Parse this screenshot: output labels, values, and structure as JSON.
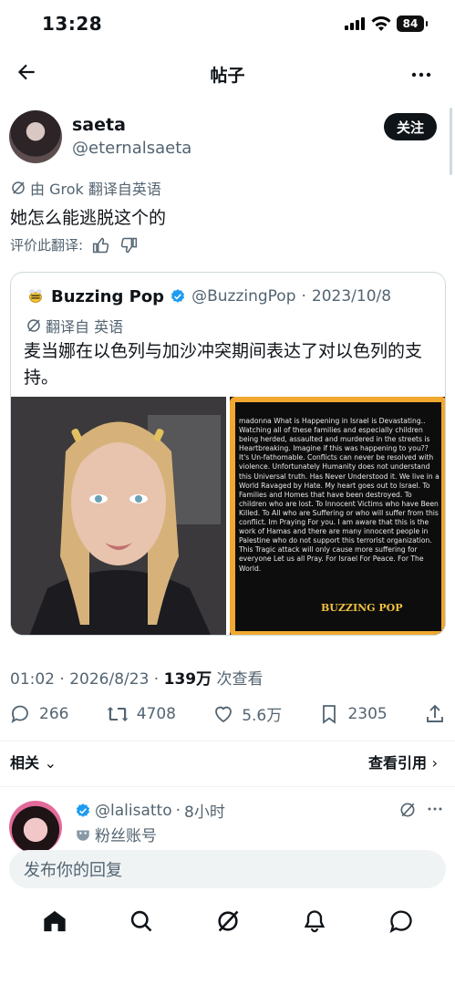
{
  "status": {
    "time": "13:28",
    "battery": "84"
  },
  "header": {
    "title": "帖子"
  },
  "post": {
    "author_name": "saeta",
    "author_handle": "@eternalsaeta",
    "follow_label": "关注",
    "translated_by": "由 Grok 翻译自英语",
    "text": "她怎么能逃脱这个的",
    "rate_label": "评价此翻译:"
  },
  "quote": {
    "name": "Buzzing Pop",
    "handle": "@BuzzingPop",
    "date": "2023/10/8",
    "translated_label": "翻译自 英语",
    "text": "麦当娜在以色列与加沙冲突期间表达了对以色列的支持。",
    "image_text": "madonna What is  Happening in Israel  is Devastating.. Watching all of these families and especially children being herded, assaulted and murdered in the streets  is Heartbreaking. Imagine if this was happening to you?? It's Un-fathomable. Conflicts can never be resolved  with violence. Unfortunately Humanity  does not understand this Universal  truth.  Has Never Understood it. We live in a World Ravaged by Hate. My heart goes out to Israel. To Families  and Homes that have been destroyed. To children who  are lost. To Innocent Victims who have Been Killed. To All  who are Suffering or who will suffer from this conflict. Im Praying For you.  I am aware that this is the work of Hamas and there are many innocent people in Palestine who do not support this terrorist organization. This Tragic attack will only cause more suffering for everyone Let us all Pray.  For Israel  For Peace. For The World.",
    "image_logo": "BUZZING POP"
  },
  "stats": {
    "time": "01:02",
    "date": "2026/8/23",
    "views": "139万",
    "views_label": "次查看",
    "replies": "266",
    "reposts": "4708",
    "likes": "5.6万",
    "bookmarks": "2305"
  },
  "links": {
    "related": "相关",
    "view_quotes": "查看引用"
  },
  "reply": {
    "handle": "@lalisatto",
    "time": "8小时",
    "badge": "粉丝账号"
  },
  "compose": {
    "placeholder": "发布你的回复"
  },
  "icons": {
    "back": "arrow-left-icon",
    "more": "more-horizontal-icon",
    "grok": "grok-icon",
    "verified": "verified-badge-icon",
    "reply": "reply-icon",
    "repost": "repost-icon",
    "like": "heart-icon",
    "bookmark": "bookmark-icon",
    "share": "share-icon",
    "home": "home-icon",
    "search": "search-icon",
    "notifications": "bell-icon",
    "messages": "message-icon"
  },
  "colors": {
    "accent": "#1d9bf0",
    "text": "#0f1419",
    "muted": "#536471"
  }
}
